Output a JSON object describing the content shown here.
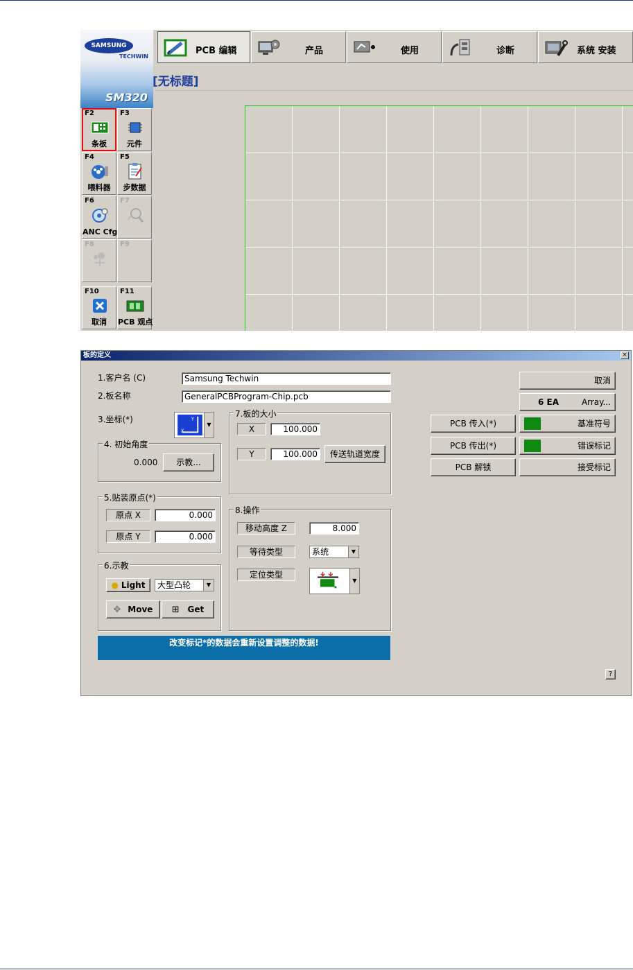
{
  "brand": {
    "company": "SAMSUNG",
    "division": "TECHWIN",
    "model": "SM320"
  },
  "tabs": [
    {
      "label": "PCB 编辑",
      "icon": "pcb-edit-icon"
    },
    {
      "label": "产品",
      "icon": "production-icon"
    },
    {
      "label": "使用",
      "icon": "utility-icon"
    },
    {
      "label": "诊断",
      "icon": "diagnosis-icon"
    },
    {
      "label": "系统 安装",
      "icon": "system-setup-icon"
    }
  ],
  "document_title": "[无标题]",
  "fkeys": [
    {
      "key": "F2",
      "label": "条板",
      "icon": "board-icon",
      "enabled": true,
      "selected": true
    },
    {
      "key": "F3",
      "label": "元件",
      "icon": "part-icon",
      "enabled": true,
      "selected": false
    },
    {
      "key": "F4",
      "label": "喂料器",
      "icon": "feeder-icon",
      "enabled": true,
      "selected": false
    },
    {
      "key": "F5",
      "label": "步数据",
      "icon": "step-data-icon",
      "enabled": true,
      "selected": false
    },
    {
      "key": "F6",
      "label": "ANC Cfg",
      "icon": "anc-config-icon",
      "enabled": true,
      "selected": false
    },
    {
      "key": "F7",
      "label": "",
      "icon": "search-icon",
      "enabled": false,
      "selected": false
    },
    {
      "key": "F8",
      "label": "",
      "icon": "nozzle-icon",
      "enabled": false,
      "selected": false
    },
    {
      "key": "F9",
      "label": "",
      "icon": "",
      "enabled": false,
      "selected": false
    },
    {
      "key": "F10",
      "label": "取消",
      "icon": "cancel-icon",
      "enabled": true,
      "selected": false
    },
    {
      "key": "F11",
      "label": "PCB 观点",
      "icon": "pcb-view-icon",
      "enabled": true,
      "selected": false
    }
  ],
  "dialog": {
    "title": "板的定义",
    "close": "×",
    "customer_label": "1.客户名 (C)",
    "customer_value": "Samsung Techwin",
    "board_label": "2.板名称",
    "board_value": "GeneralPCBProgram-Chip.pcb",
    "coord_label": "3.坐标(*)",
    "angle_group": "4. 初始角度",
    "angle_value": "0.000",
    "teach_button": "示教...",
    "origin_group": "5.贴装原点(*)",
    "origin_x_label": "原点 X",
    "origin_x_value": "0.000",
    "origin_y_label": "原点 Y",
    "origin_y_value": "0.000",
    "teach_group": "6.示教",
    "light_button": "Light",
    "light_select": "大型凸轮",
    "move_button": "Move",
    "get_button": "Get",
    "size_group": "7.板的大小",
    "size_x_label": "X",
    "size_x_value": "100.000",
    "size_y_label": "Y",
    "size_y_value": "100.000",
    "conveyor_button": "传送轨道宽度",
    "operation_group": "8.操作",
    "move_z_label": "移动高度 Z",
    "move_z_value": "8.000",
    "wait_type_label": "等待类型",
    "wait_type_value": "系统",
    "locate_type_label": "定位类型",
    "cancel_button": "取消",
    "array_count": "6 EA",
    "array_button": "Array...",
    "pcb_in_button": "PCB 传入(*)",
    "pcb_out_button": "PCB 传出(*)",
    "pcb_unlock_button": "PCB 解锁",
    "fiducial_button": "基准符号",
    "bad_mark_button": "错误标记",
    "accept_mark_button": "接受标记",
    "message": "改变标记*的数据会重新设置调整的数据!",
    "help_button": "?"
  },
  "colors": {
    "header_rule": "#1a2f8f",
    "message_bg": "#0b6ea8",
    "board_outline": "#22cc22",
    "mark_green": "#118811",
    "selected_outline": "#e01010"
  }
}
